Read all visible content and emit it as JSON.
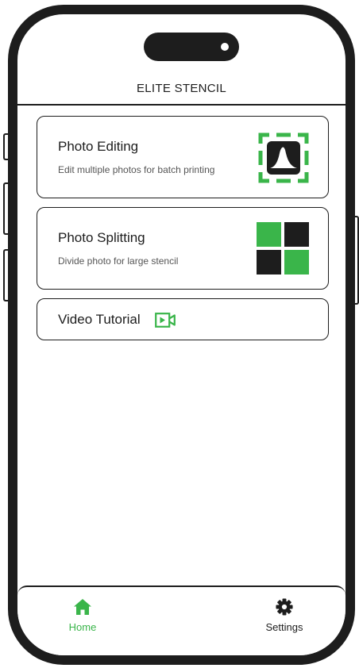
{
  "header": {
    "title": "ELITE STENCIL"
  },
  "cards": [
    {
      "title": "Photo Editing",
      "subtitle": "Edit multiple photos for batch printing",
      "icon": "photo-edit-icon"
    },
    {
      "title": "Photo Splitting",
      "subtitle": "Divide photo for large stencil",
      "icon": "grid-split-icon"
    }
  ],
  "tutorial": {
    "label": "Video Tutorial",
    "icon": "video-camera-icon"
  },
  "tabs": [
    {
      "label": "Home",
      "icon": "home-icon",
      "active": true
    },
    {
      "label": "Settings",
      "icon": "gear-icon",
      "active": false
    }
  ],
  "colors": {
    "accent": "#3ab54a",
    "ink": "#1d1d1d",
    "subtext": "#555555",
    "background": "#ffffff"
  }
}
